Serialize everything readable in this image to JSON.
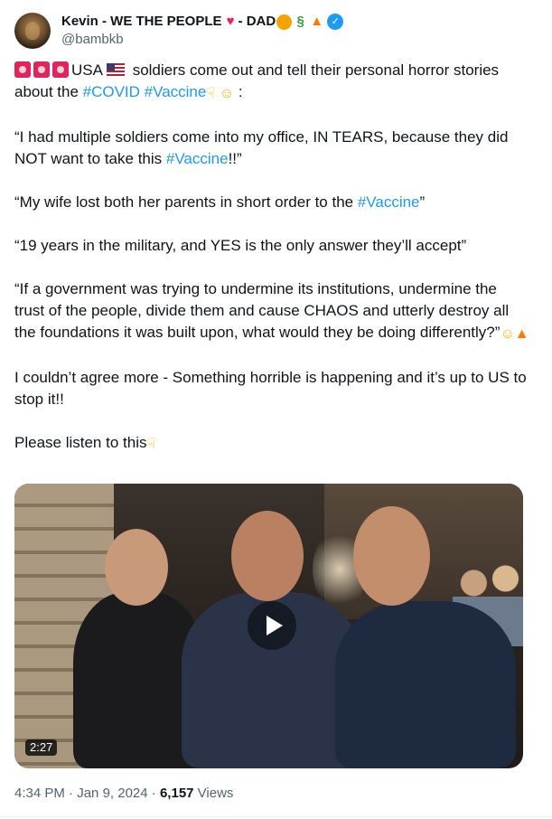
{
  "author": {
    "display_name": "Kevin - WE THE PEOPLE",
    "display_suffix": " - DAD",
    "handle": "@bambkb",
    "badges": [
      "heart-emoji",
      "lion-emoji",
      "dragon-emoji",
      "fire-emoji",
      "verified-badge"
    ]
  },
  "tweet": {
    "line1_start": "USA",
    "line1_rest": " soldiers come out and tell their personal horror stories about the ",
    "hashtag_covid": "#COVID",
    "hashtag_vaccine_1": "#Vaccine",
    "line1_end": " :",
    "quote1_a": "“I had multiple soldiers come into my office, IN TEARS, because they did NOT want to take this ",
    "hashtag_vaccine_2": "#Vaccine",
    "quote1_b": "!!”",
    "quote2_a": "“My wife lost both her parents in short order to the ",
    "hashtag_vaccine_3": "#Vaccine",
    "quote2_b": "”",
    "quote3": "“19 years in the military, and YES is the only answer they’ll accept”",
    "quote4": "“If a government was trying to undermine its institutions, undermine the trust of the people, divide them and cause CHAOS and utterly destroy all the foundations it was built upon, what would they be doing differently?”",
    "para_agree": "I couldn’t agree more - Something horrible is happening and it’s up to US to stop it!!",
    "para_listen": "Please listen to this"
  },
  "video": {
    "duration": "2:27"
  },
  "meta": {
    "time": "4:34 PM",
    "separator1": " · ",
    "date": "Jan 9, 2024",
    "separator2": " · ",
    "views_count": "6,157",
    "views_label": " Views"
  },
  "colors": {
    "link": "#1d9bf0",
    "text": "#0f1419",
    "secondary": "#536471"
  }
}
